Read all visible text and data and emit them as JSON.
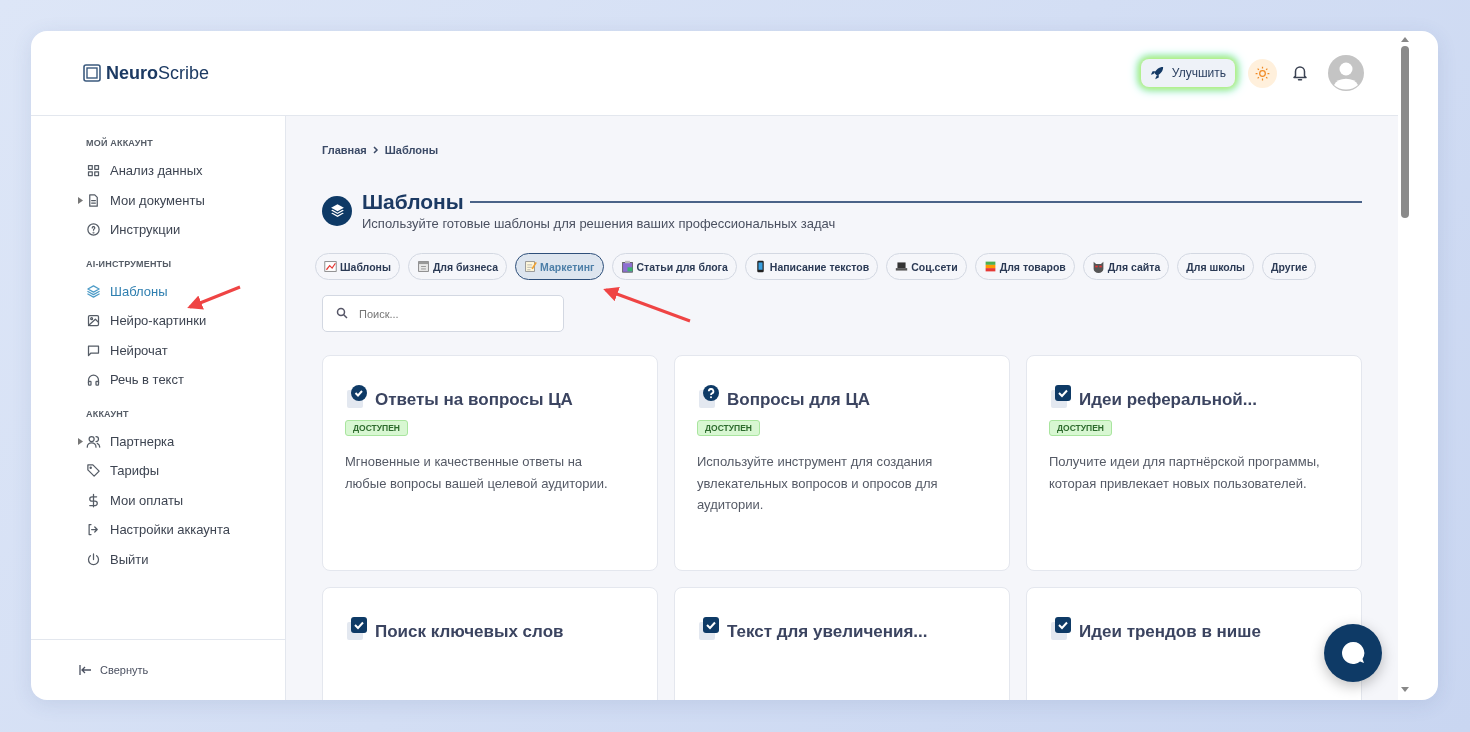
{
  "logo": "**Neuro**Scribe",
  "header": {
    "upgrade_button": "Улучшить"
  },
  "sidebar": {
    "sections": [
      {
        "title": "МОЙ АККАУНТ",
        "items": [
          {
            "label": "Анализ данных",
            "kind": "grid",
            "selected": false
          },
          {
            "label": "Мои документы",
            "kind": "doc",
            "expanded": false,
            "selected": false
          },
          {
            "label": "Инструкции",
            "kind": "help",
            "selected": false
          }
        ]
      },
      {
        "title": "AI-ИНСТРУМЕНТЫ",
        "items": [
          {
            "label": "Шаблоны",
            "kind": "layers",
            "selected": true
          },
          {
            "label": "Нейро-картинки",
            "kind": "image",
            "selected": false
          },
          {
            "label": "Нейрочат",
            "kind": "chat",
            "selected": false
          },
          {
            "label": "Речь в текст",
            "kind": "headphones",
            "selected": false
          }
        ]
      },
      {
        "title": "АККАУНТ",
        "items": [
          {
            "label": "Партнерка",
            "kind": "users",
            "expanded": false,
            "selected": false
          },
          {
            "label": "Тарифы",
            "kind": "tag",
            "selected": false
          },
          {
            "label": "Мои оплаты",
            "kind": "dollar",
            "selected": false
          },
          {
            "label": "Настройки аккаунта",
            "kind": "logout",
            "selected": false
          },
          {
            "label": "Выйти",
            "kind": "power",
            "selected": false
          }
        ]
      }
    ],
    "collapse": "Свернуть"
  },
  "breadcrumb": [
    "Главная",
    "Шаблоны"
  ],
  "page": {
    "title": "Шаблоны",
    "subtitle": "Используйте готовые шаблоны для решения ваших профессиональных задач"
  },
  "filters": [
    {
      "label": "Шаблоны",
      "kind": "chart",
      "selected": false
    },
    {
      "label": "Для бизнеса",
      "kind": "calendar",
      "selected": false
    },
    {
      "label": "Маркетинг",
      "kind": "memo",
      "selected": true
    },
    {
      "label": "Статьи для блога",
      "kind": "clipboard",
      "selected": false
    },
    {
      "label": "Написание текстов",
      "kind": "phone",
      "selected": false
    },
    {
      "label": "Соц.сети",
      "kind": "laptop",
      "selected": false
    },
    {
      "label": "Для товаров",
      "kind": "books",
      "selected": false
    },
    {
      "label": "Для сайта",
      "kind": "cat",
      "selected": false
    },
    {
      "label": "Для школы",
      "selected": false
    },
    {
      "label": "Другие",
      "selected": false
    }
  ],
  "search": {
    "placeholder": "Поиск..."
  },
  "cards": [
    {
      "title": "Ответы на вопросы ЦА",
      "kind": "check-circle",
      "status": "ДОСТУПЕН",
      "description": "Мгновенные и качественные ответы на любые вопросы вашей целевой аудитории."
    },
    {
      "title": "Вопросы для ЦА",
      "kind": "question-circle",
      "status": "ДОСТУПЕН",
      "description": "Используйте инструмент для создания увлекательных вопросов и опросов для аудитории."
    },
    {
      "title": "Идеи реферальной...",
      "kind": "check-square",
      "status": "ДОСТУПЕН",
      "description": "Получите идеи для партнёрской программы, которая привлекает новых пользователей."
    },
    {
      "title": "Поиск ключевых слов",
      "kind": "check-square"
    },
    {
      "title": "Текст для увеличения...",
      "kind": "check-square"
    },
    {
      "title": "Идеи трендов в нише",
      "kind": "check-square"
    }
  ]
}
